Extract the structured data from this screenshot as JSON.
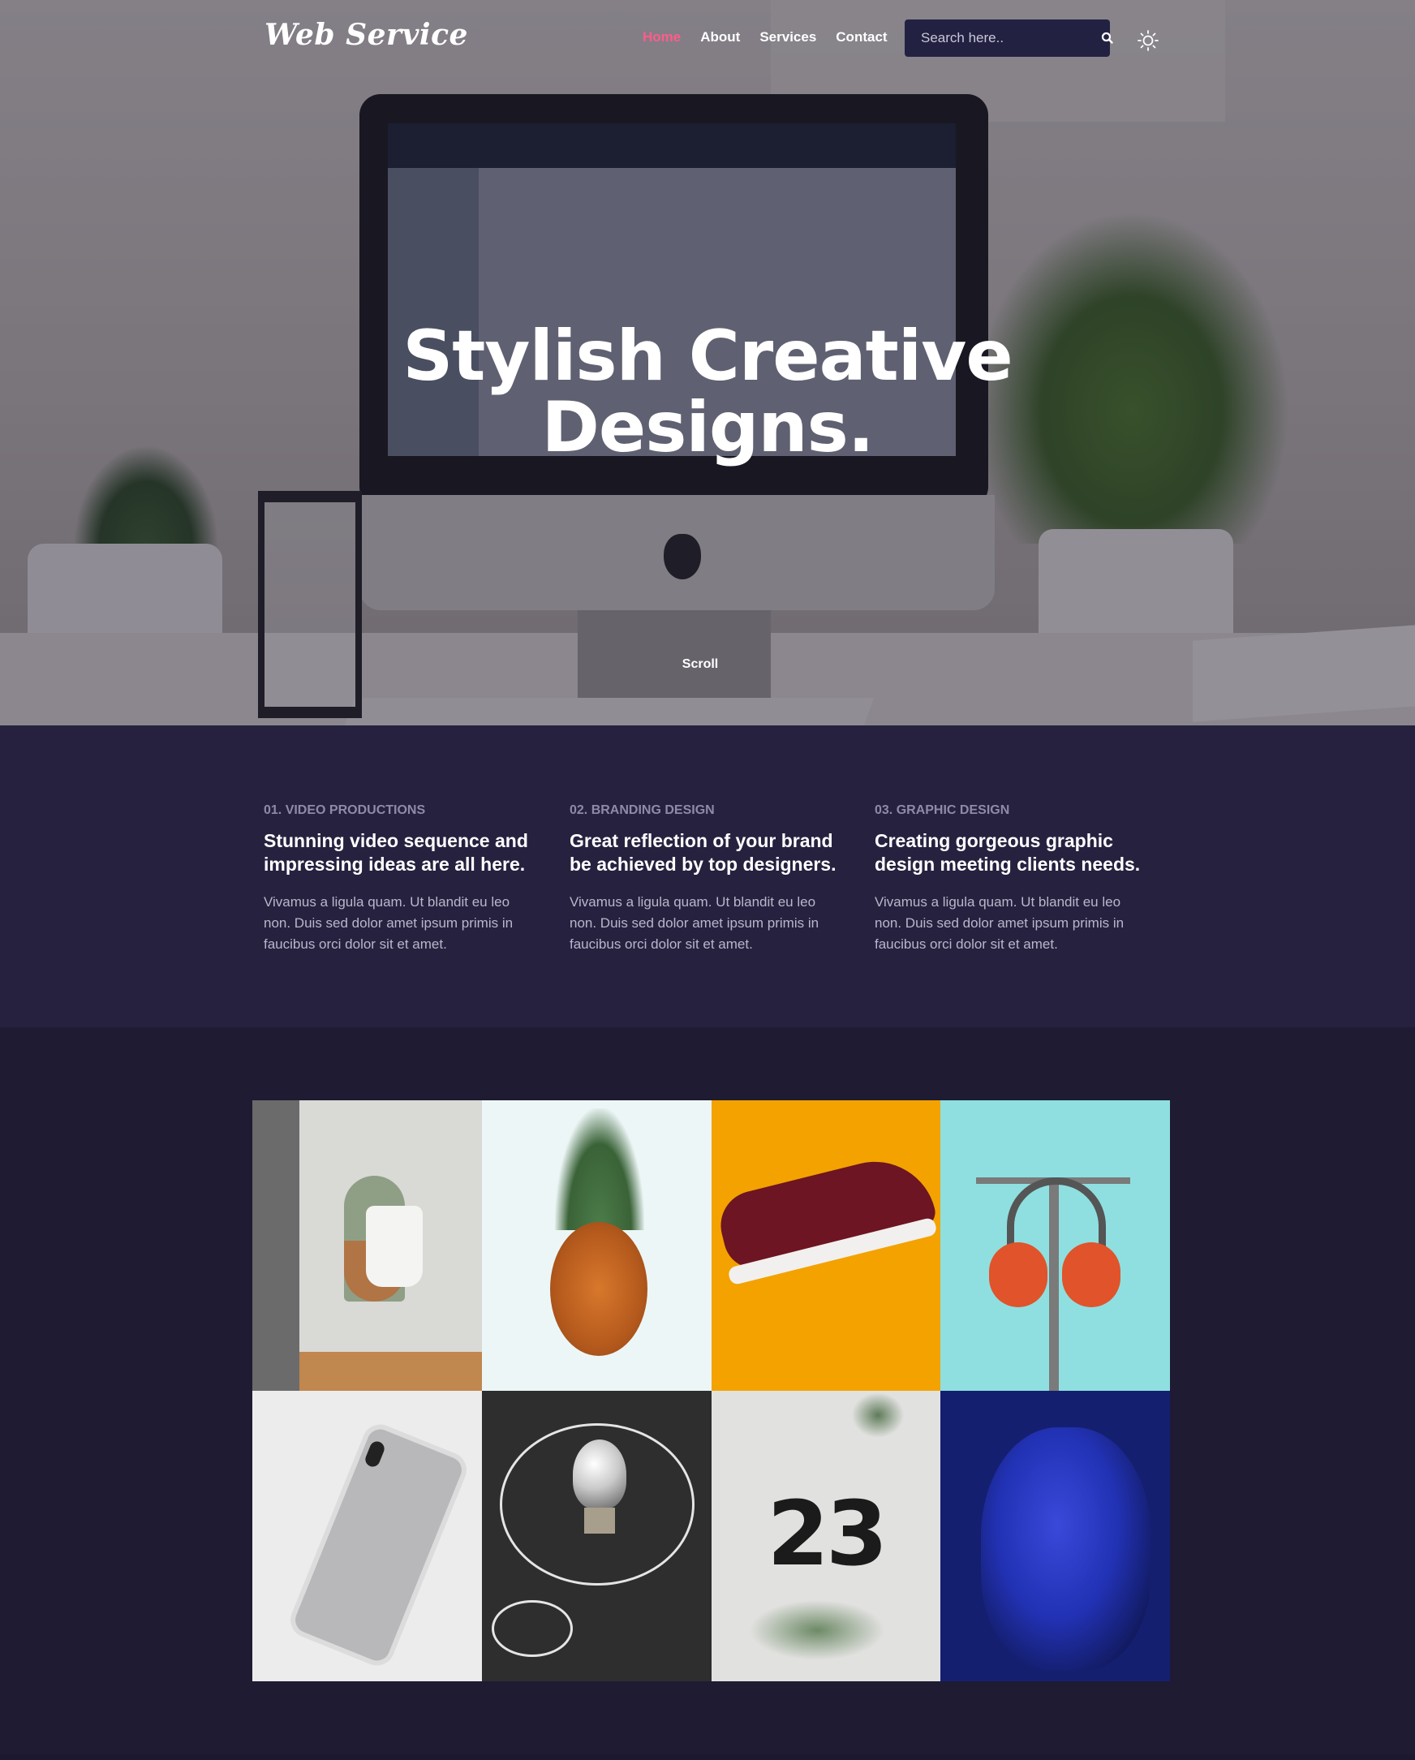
{
  "header": {
    "logo": "Web Service",
    "nav": [
      {
        "label": "Home",
        "active": true
      },
      {
        "label": "About",
        "active": false
      },
      {
        "label": "Services",
        "active": false
      },
      {
        "label": "Contact",
        "active": false
      }
    ],
    "search_placeholder": "Search here..",
    "icons": {
      "search": "search-icon",
      "theme": "sun-icon"
    }
  },
  "hero": {
    "title_line1": "Stylish Creative",
    "title_line2": "Designs.",
    "scroll_label": "Scroll"
  },
  "services": [
    {
      "number": "01. VIDEO PRODUCTIONS",
      "heading": "Stunning video sequence and impressing ideas are all here.",
      "description": "Vivamus a ligula quam. Ut blandit eu leo non. Duis sed dolor amet ipsum primis in faucibus orci dolor sit et amet."
    },
    {
      "number": "02. BRANDING DESIGN",
      "heading": "Great reflection of your brand be achieved by top designers.",
      "description": "Vivamus a ligula quam. Ut blandit eu leo non. Duis sed dolor amet ipsum primis in faucibus orci dolor sit et amet."
    },
    {
      "number": "03. GRAPHIC DESIGN",
      "heading": "Creating gorgeous graphic design meeting clients needs.",
      "description": "Vivamus a ligula quam. Ut blandit eu leo non. Duis sed dolor amet ipsum primis in faucibus orci dolor sit et amet."
    }
  ],
  "gallery": {
    "tiles": [
      "cup-holder",
      "pineapple",
      "sneaker",
      "headphones",
      "smartphone",
      "light-bulb",
      "number-23",
      "portrait"
    ],
    "tile_7_text": "23"
  },
  "colors": {
    "accent": "#ff5c8a",
    "services_bg": "#25213f",
    "gallery_bg": "#1e1b33",
    "search_bg": "#232142"
  }
}
